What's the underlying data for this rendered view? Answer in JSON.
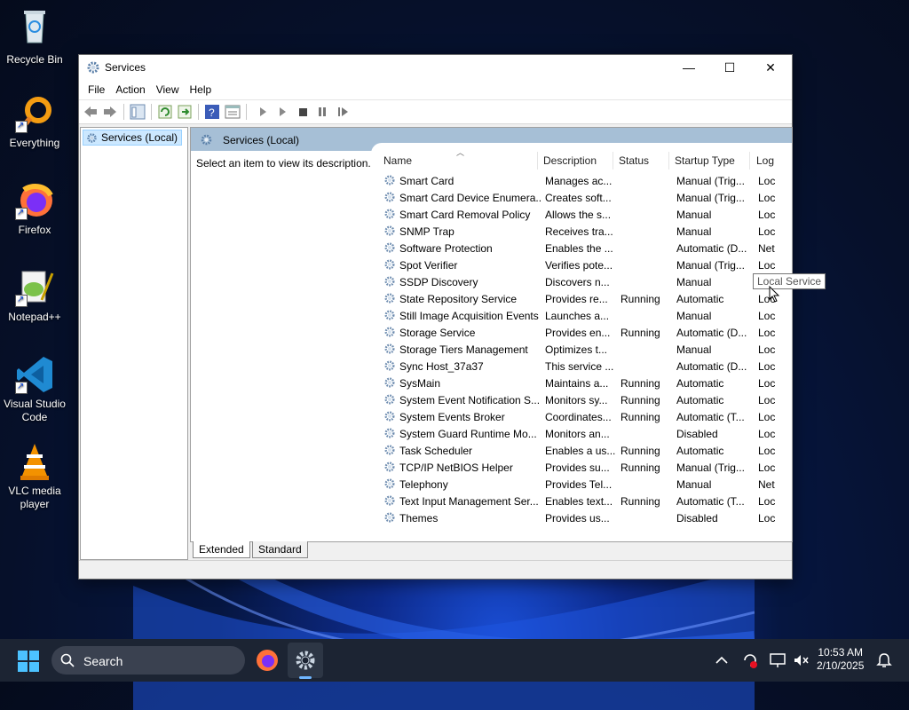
{
  "desktop": {
    "icons": [
      {
        "label": "Recycle Bin"
      },
      {
        "label": "Everything"
      },
      {
        "label": "Firefox"
      },
      {
        "label": "Notepad++"
      },
      {
        "label": "Visual Studio Code"
      },
      {
        "label": "VLC media player"
      }
    ]
  },
  "window": {
    "title": "Services",
    "menu": [
      "File",
      "Action",
      "View",
      "Help"
    ],
    "tree_item": "Services (Local)",
    "header": "Services (Local)",
    "description_prompt": "Select an item to view its description.",
    "columns": [
      "Name",
      "Description",
      "Status",
      "Startup Type",
      "Log"
    ],
    "rows": [
      {
        "name": "Smart Card",
        "desc": "Manages ac...",
        "status": "",
        "startup": "Manual (Trig...",
        "log": "Loc"
      },
      {
        "name": "Smart Card Device Enumera...",
        "desc": "Creates soft...",
        "status": "",
        "startup": "Manual (Trig...",
        "log": "Loc"
      },
      {
        "name": "Smart Card Removal Policy",
        "desc": "Allows the s...",
        "status": "",
        "startup": "Manual",
        "log": "Loc"
      },
      {
        "name": "SNMP Trap",
        "desc": "Receives tra...",
        "status": "",
        "startup": "Manual",
        "log": "Loc"
      },
      {
        "name": "Software Protection",
        "desc": "Enables the ...",
        "status": "",
        "startup": "Automatic (D...",
        "log": "Net"
      },
      {
        "name": "Spot Verifier",
        "desc": "Verifies pote...",
        "status": "",
        "startup": "Manual (Trig...",
        "log": "Loc"
      },
      {
        "name": "SSDP Discovery",
        "desc": "Discovers n...",
        "status": "",
        "startup": "Manual",
        "log": "Loc"
      },
      {
        "name": "State Repository Service",
        "desc": "Provides re...",
        "status": "Running",
        "startup": "Automatic",
        "log": "Loc"
      },
      {
        "name": "Still Image Acquisition Events",
        "desc": "Launches a...",
        "status": "",
        "startup": "Manual",
        "log": "Loc"
      },
      {
        "name": "Storage Service",
        "desc": "Provides en...",
        "status": "Running",
        "startup": "Automatic (D...",
        "log": "Loc"
      },
      {
        "name": "Storage Tiers Management",
        "desc": "Optimizes t...",
        "status": "",
        "startup": "Manual",
        "log": "Loc"
      },
      {
        "name": "Sync Host_37a37",
        "desc": "This service ...",
        "status": "",
        "startup": "Automatic (D...",
        "log": "Loc"
      },
      {
        "name": "SysMain",
        "desc": "Maintains a...",
        "status": "Running",
        "startup": "Automatic",
        "log": "Loc"
      },
      {
        "name": "System Event Notification S...",
        "desc": "Monitors sy...",
        "status": "Running",
        "startup": "Automatic",
        "log": "Loc"
      },
      {
        "name": "System Events Broker",
        "desc": "Coordinates...",
        "status": "Running",
        "startup": "Automatic (T...",
        "log": "Loc"
      },
      {
        "name": "System Guard Runtime Mo...",
        "desc": "Monitors an...",
        "status": "",
        "startup": "Disabled",
        "log": "Loc"
      },
      {
        "name": "Task Scheduler",
        "desc": "Enables a us...",
        "status": "Running",
        "startup": "Automatic",
        "log": "Loc"
      },
      {
        "name": "TCP/IP NetBIOS Helper",
        "desc": "Provides su...",
        "status": "Running",
        "startup": "Manual (Trig...",
        "log": "Loc"
      },
      {
        "name": "Telephony",
        "desc": "Provides Tel...",
        "status": "",
        "startup": "Manual",
        "log": "Net"
      },
      {
        "name": "Text Input Management Ser...",
        "desc": "Enables text...",
        "status": "Running",
        "startup": "Automatic (T...",
        "log": "Loc"
      },
      {
        "name": "Themes",
        "desc": "Provides us...",
        "status": "",
        "startup": "Disabled",
        "log": "Loc"
      }
    ],
    "tabs": [
      "Extended",
      "Standard"
    ],
    "tooltip": "Local Service"
  },
  "taskbar": {
    "search_label": "Search",
    "time": "10:53 AM",
    "date": "2/10/2025"
  },
  "colors": {
    "header_bg": "#a6bfd6",
    "selection": "#cce8ff",
    "taskbar": "#1c2433"
  }
}
